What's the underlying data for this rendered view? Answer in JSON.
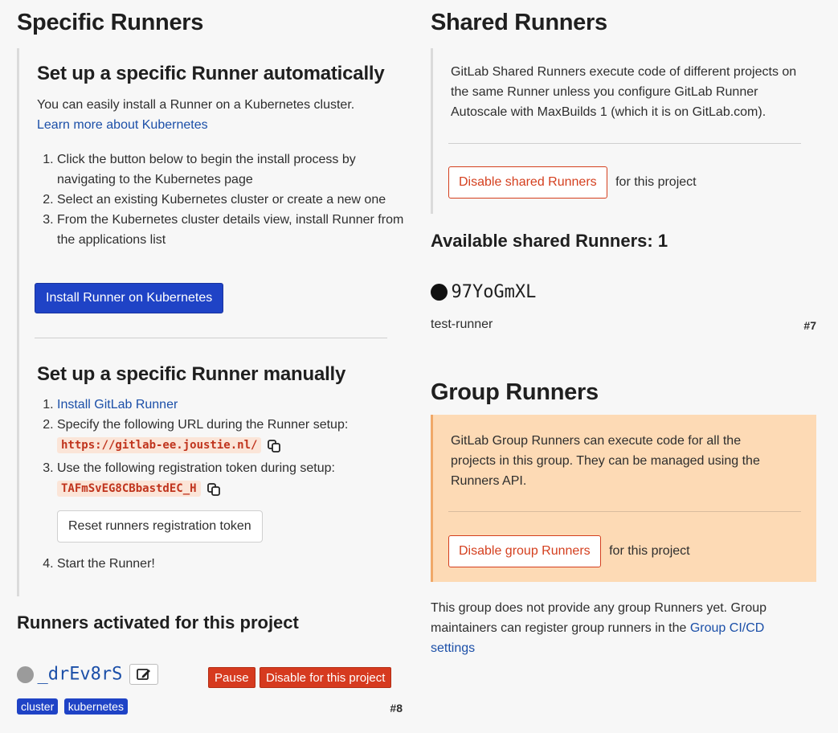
{
  "specific": {
    "title": "Specific Runners",
    "auto": {
      "title": "Set up a specific Runner automatically",
      "desc": "You can easily install a Runner on a Kubernetes cluster.",
      "learn_link": "Learn more about Kubernetes",
      "steps": [
        "Click the button below to begin the install process by navigating to the Kubernetes page",
        "Select an existing Kubernetes cluster or create a new one",
        "From the Kubernetes cluster details view, install Runner from the applications list"
      ],
      "install_button": "Install Runner on Kubernetes"
    },
    "manual": {
      "title": "Set up a specific Runner manually",
      "step1_link": "Install GitLab Runner",
      "step2_text": "Specify the following URL during the Runner setup:",
      "url": "https://gitlab-ee.joustie.nl/",
      "step3_text": "Use the following registration token during setup:",
      "token": "TAFmSvEG8CBbastdEC_H",
      "reset_button": "Reset runners registration token",
      "step4_text": "Start the Runner!"
    },
    "activated": {
      "title": "Runners activated for this project",
      "runner_name": "_drEv8rS",
      "pause_button": "Pause",
      "disable_button": "Disable for this project",
      "tags": [
        "cluster",
        "kubernetes"
      ],
      "runner_id": "#8",
      "status_color": "#9b9b9b"
    }
  },
  "shared": {
    "title": "Shared Runners",
    "desc": "GitLab Shared Runners execute code of different projects on the same Runner unless you configure GitLab Runner Autoscale with MaxBuilds 1 (which it is on GitLab.com).",
    "disable_button": "Disable shared Runners",
    "suffix": "for this project",
    "available_title": "Available shared Runners: 1",
    "runner_name": "97YoGmXL",
    "runner_desc": "test-runner",
    "runner_id": "#7",
    "status_color": "#111111"
  },
  "group": {
    "title": "Group Runners",
    "desc": "GitLab Group Runners can execute code for all the projects in this group. They can be managed using the Runners API.",
    "disable_button": "Disable group Runners",
    "suffix": "for this project",
    "note_prefix": "This group does not provide any group Runners yet. Group maintainers can register group runners in the",
    "note_link": "Group CI/CD settings"
  },
  "icons": {
    "copy": "copy-icon",
    "edit": "edit-icon"
  },
  "colors": {
    "primary": "#1f43c6",
    "danger": "#d43f1e",
    "group_bg": "#fddab5"
  }
}
